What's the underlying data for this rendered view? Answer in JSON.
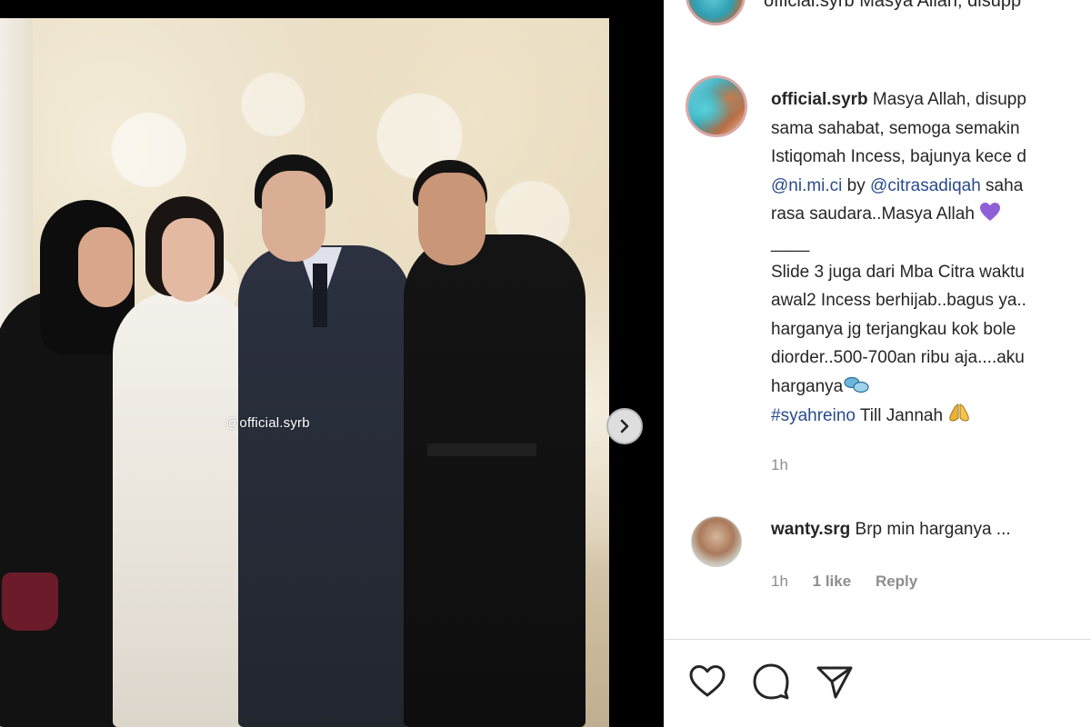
{
  "top": {
    "partial_text": "official.syrb Masya Allah, disupp"
  },
  "post": {
    "watermark": "@official.syrb",
    "caption": {
      "username": "official.syrb",
      "line1_text": " Masya Allah, disupp",
      "line2": "sama sahabat, semoga semakin",
      "line3": "Istiqomah Incess, bajunya kece d",
      "line4_mention1": "@ni.mi.ci",
      "line4_mid": " by ",
      "line4_mention2": "@citrasadiqah",
      "line4_tail": " saha",
      "line5": "rasa saudara..Masya Allah ",
      "line6": "____",
      "line7": "Slide 3 juga dari Mba Citra waktu",
      "line8": "awal2 Incess berhijab..bagus ya..",
      "line9": "harganya jg terjangkau kok bole",
      "line10": "diorder..500-700an ribu aja....aku",
      "line11": "harganya",
      "line12_hashtag": "#syahreino",
      "line12_tail": " Till Jannah "
    },
    "time": "1h"
  },
  "comment": {
    "username": "wanty.srg",
    "text": " Brp min harganya ...",
    "time": "1h",
    "likes": "1 like",
    "reply": "Reply"
  },
  "colors": {
    "link": "#2a4a8c",
    "muted": "#8e8e8e",
    "text": "#262626",
    "heart_emoji": "#8e5fd6",
    "pray_emoji": "#e9b338"
  },
  "icons": {
    "like": "heart-icon",
    "comment": "comment-icon",
    "share": "share-icon",
    "next": "chevron-right-icon"
  }
}
